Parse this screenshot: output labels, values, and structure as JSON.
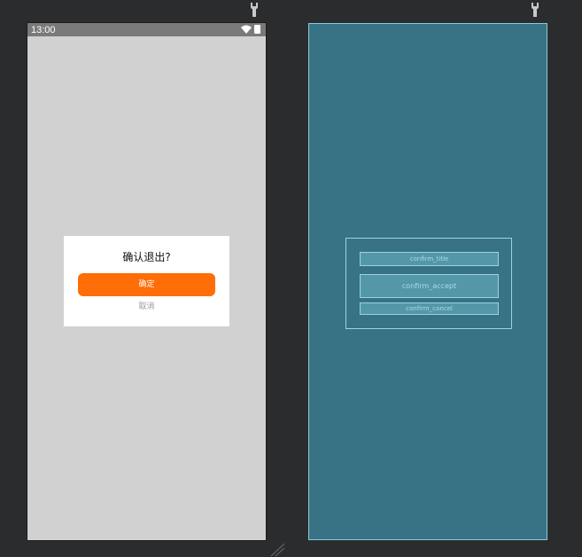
{
  "status_bar": {
    "time": "13:00"
  },
  "dialog": {
    "title": "确认退出?",
    "accept_label": "确定",
    "cancel_label": "取消"
  },
  "blueprint": {
    "title_id": "confirm_title",
    "accept_id": "confirm_accept",
    "cancel_id": "confirm_cancel"
  },
  "colors": {
    "workspace": "#2b2c2e",
    "phone_background": "#d1d1d1",
    "status_bar": "#7a7a7a",
    "accent": "#ff6d06",
    "blueprint": "#377384",
    "blueprint_outline": "#9ad4e2"
  },
  "icons": [
    "pin-icon",
    "wifi-icon",
    "battery-icon",
    "resize-handle-icon"
  ]
}
